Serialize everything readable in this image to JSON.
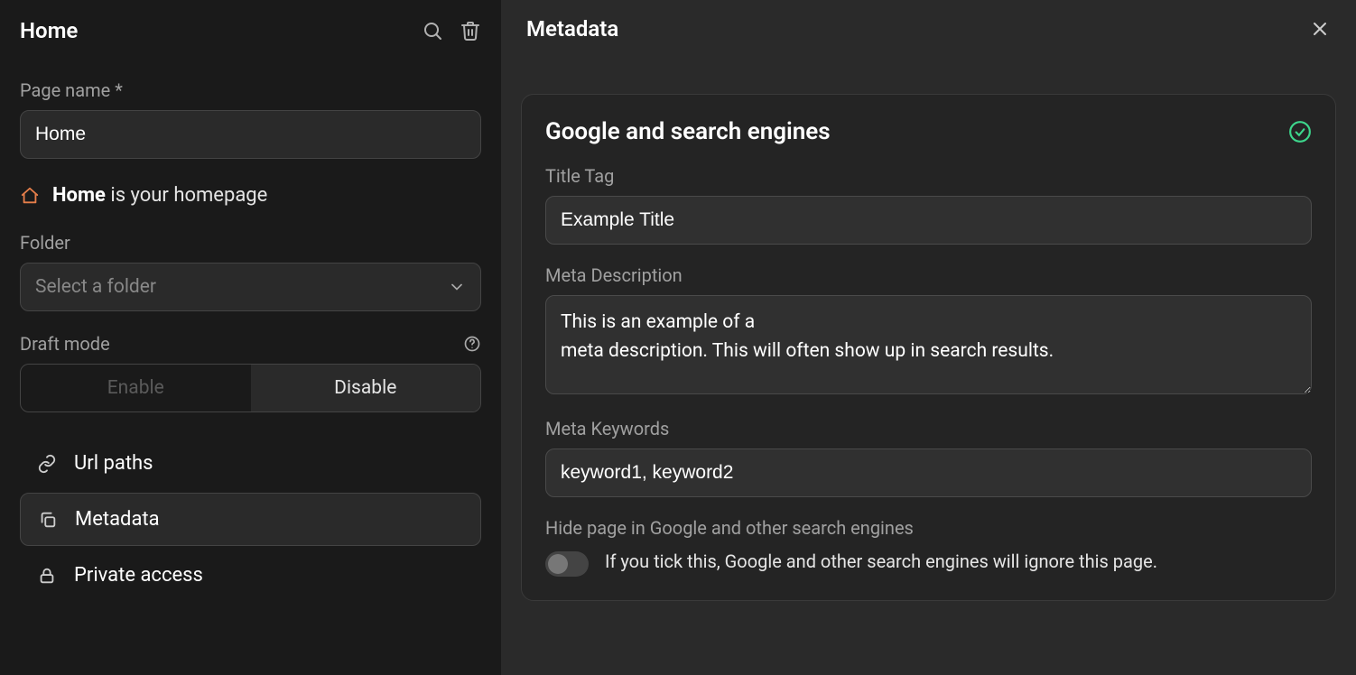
{
  "left": {
    "title": "Home",
    "page_name_label": "Page name *",
    "page_name_value": "Home",
    "homepage_strong": "Home",
    "homepage_rest": " is your homepage",
    "folder_label": "Folder",
    "folder_placeholder": "Select a folder",
    "draft_label": "Draft mode",
    "enable_label": "Enable",
    "disable_label": "Disable",
    "nav": {
      "url_paths": "Url paths",
      "metadata": "Metadata",
      "private_access": "Private access"
    }
  },
  "right": {
    "title": "Metadata",
    "card_title": "Google and search engines",
    "title_tag_label": "Title Tag",
    "title_tag_value": "Example Title",
    "meta_desc_label": "Meta Description",
    "meta_desc_value": "This is an example of a\nmeta description. This will often show up in search results.",
    "meta_keywords_label": "Meta Keywords",
    "meta_keywords_value": "keyword1, keyword2",
    "hide_label": "Hide page in Google and other search engines",
    "hide_desc": "If you tick this, Google and other search engines will ignore this page."
  }
}
